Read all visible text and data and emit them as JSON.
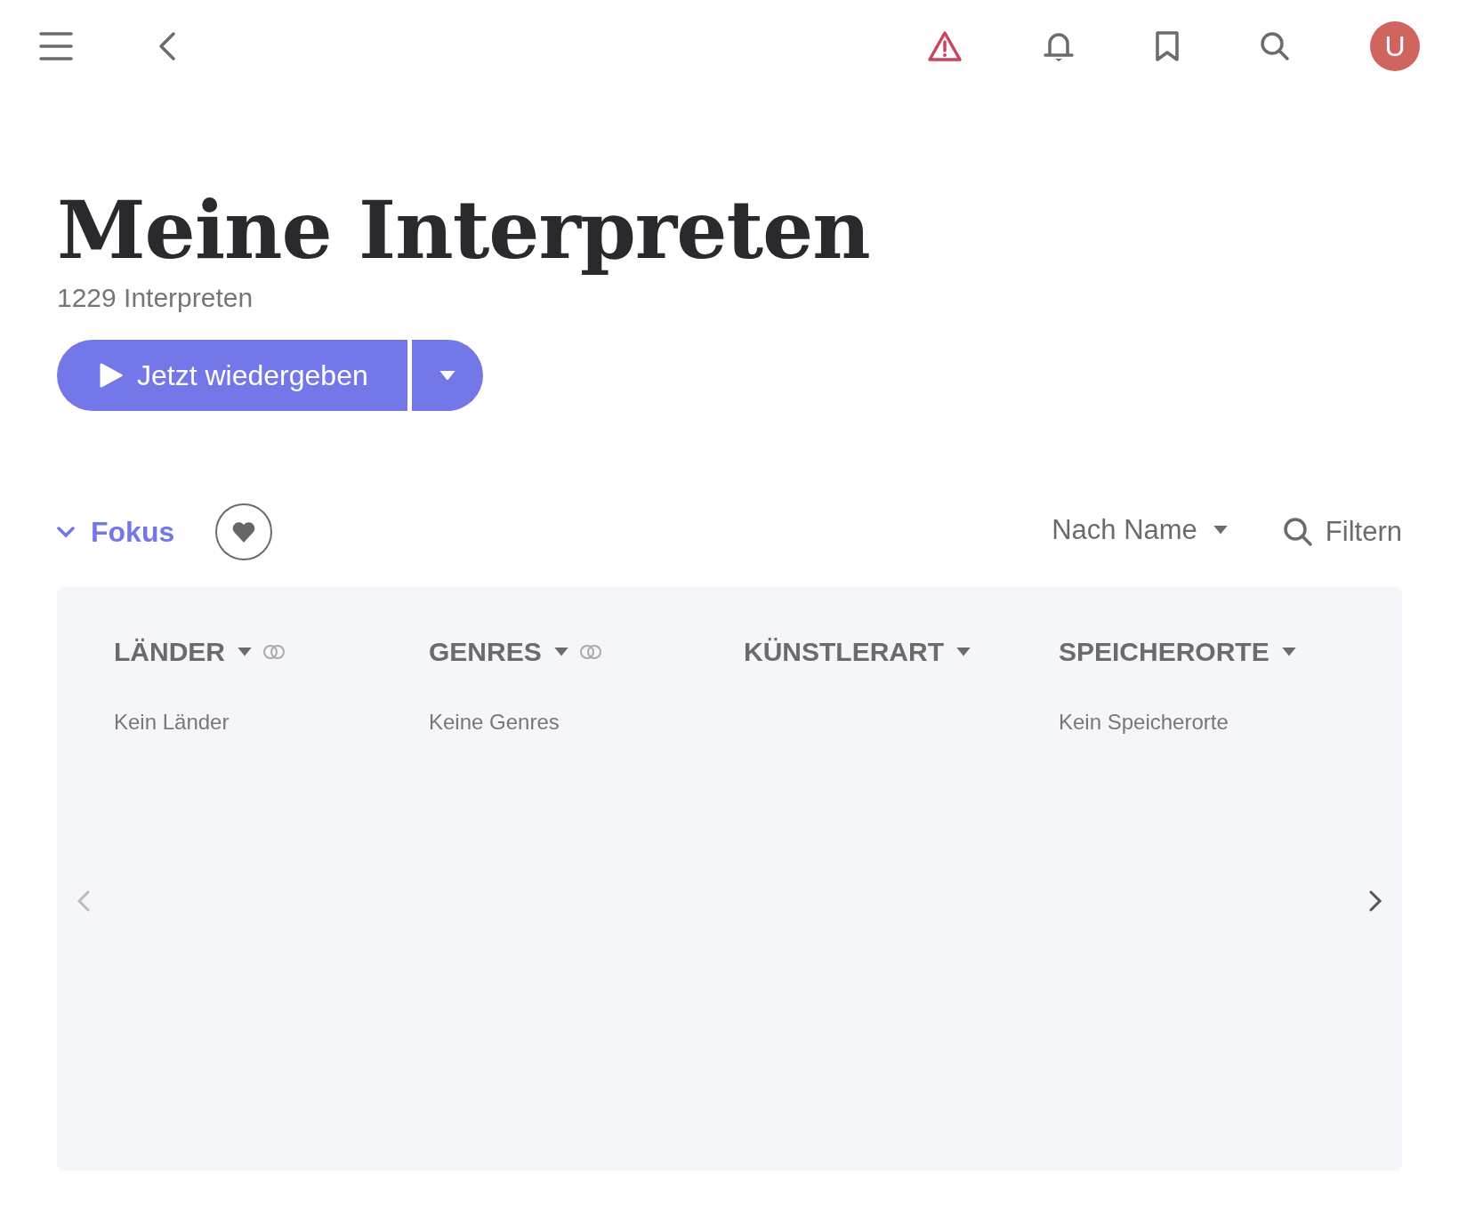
{
  "top_bar": {
    "avatar": "U"
  },
  "header": {
    "title": "Meine Interpreten",
    "subtitle": "1229 Interpreten",
    "play_button": "Jetzt wiedergeben"
  },
  "toolbar": {
    "focus": {
      "label": "Fokus",
      "expanded": true
    },
    "sort": "Nach Name",
    "filter": "Filtern"
  },
  "filter_columns": [
    {
      "title": "LÄNDER",
      "combine_icon": true,
      "empty_text": "Kein Länder"
    },
    {
      "title": "GENRES",
      "combine_icon": true,
      "empty_text": "Keine Genres"
    },
    {
      "title": "KÜNSTLERART",
      "combine_icon": false
    },
    {
      "title": "SPEICHERORTE",
      "combine_icon": false,
      "empty_text": "Kein Speicherorte"
    }
  ]
}
